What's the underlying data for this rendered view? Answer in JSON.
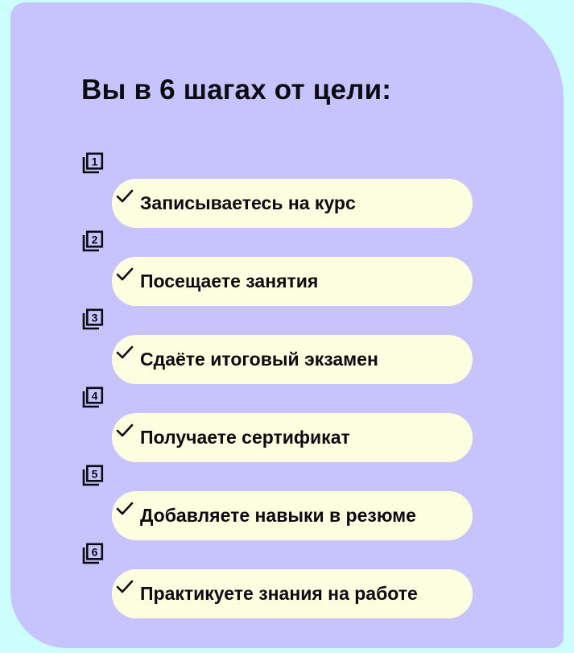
{
  "title": "Вы в 6 шагах от цели:",
  "colors": {
    "page_background": "#ccfefd",
    "card_background": "#c7c3fd",
    "pill_background": "#fdfde0",
    "text": "#0d0b12"
  },
  "steps": [
    {
      "number": "1",
      "icon": "keycap-1-icon",
      "check_icon": "checkmark-icon",
      "label": "Записываетесь на курс"
    },
    {
      "number": "2",
      "icon": "keycap-2-icon",
      "check_icon": "checkmark-icon",
      "label": "Посещаете занятия"
    },
    {
      "number": "3",
      "icon": "keycap-3-icon",
      "check_icon": "checkmark-icon",
      "label": "Сдаёте итоговый экзамен"
    },
    {
      "number": "4",
      "icon": "keycap-4-icon",
      "check_icon": "checkmark-icon",
      "label": "Получаете сертификат"
    },
    {
      "number": "5",
      "icon": "keycap-5-icon",
      "check_icon": "checkmark-icon",
      "label": "Добавляете навыки в резюме"
    },
    {
      "number": "6",
      "icon": "keycap-6-icon",
      "check_icon": "checkmark-icon",
      "label": "Практикуете знания на работе"
    }
  ]
}
